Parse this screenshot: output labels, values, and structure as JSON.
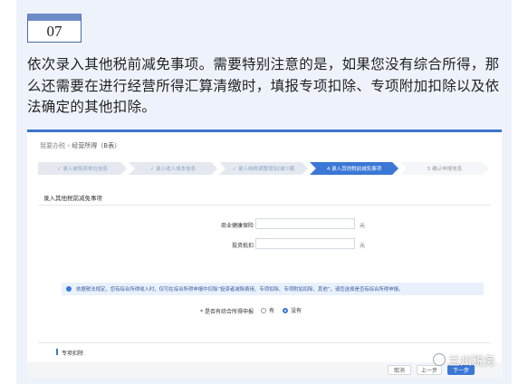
{
  "badge": {
    "number": "07"
  },
  "intro_text": "依次录入其他税前减免事项。需要特别注意的是，如果您没有综合所得，那么还需要在进行经营所得汇算清缴时，填报专项扣除、专项附加扣除以及依法确定的其他扣除。",
  "screenshot": {
    "breadcrumb": {
      "home": "我要办税",
      "sep": "›",
      "current": "经营所得（B表）"
    },
    "steps": [
      {
        "label": "✓ 录入被投资单位信息",
        "state": "done"
      },
      {
        "label": "✓ 录入收入成本信息",
        "state": "done"
      },
      {
        "label": "✓ 录入纳税调整增加/减少额",
        "state": "done"
      },
      {
        "label": "4 录入其他税前减免事项",
        "state": "active"
      },
      {
        "label": "5 确认申报信息",
        "state": "todo"
      }
    ],
    "section_title": "录入其他税前减免事项",
    "fields": [
      {
        "label": "商业健康保险",
        "value": "",
        "unit": "元"
      },
      {
        "label": "投资抵扣",
        "value": "",
        "unit": "元"
      }
    ],
    "notice": "依据税法规定，您有综合所得收入时，仅可在综合所得申报中扣除“投资者减除费用、专项扣除、专项附加扣除、其他”，请您选择是否有综合所得申报。",
    "radio": {
      "label": "* 是否有综合所得申报",
      "options": [
        {
          "label": "有",
          "selected": false
        },
        {
          "label": "没有",
          "selected": true
        }
      ]
    },
    "subsection_title": "专项扣除",
    "buttons": {
      "cancel": "取消",
      "prev": "上一步",
      "next": "下一步"
    }
  },
  "watermark": {
    "text": "兰州税务",
    "icon": "wechat-icon"
  },
  "colors": {
    "accent": "#3b78d6",
    "badge_border": "#6d8cc7",
    "card_bg": "#eef3fb"
  }
}
